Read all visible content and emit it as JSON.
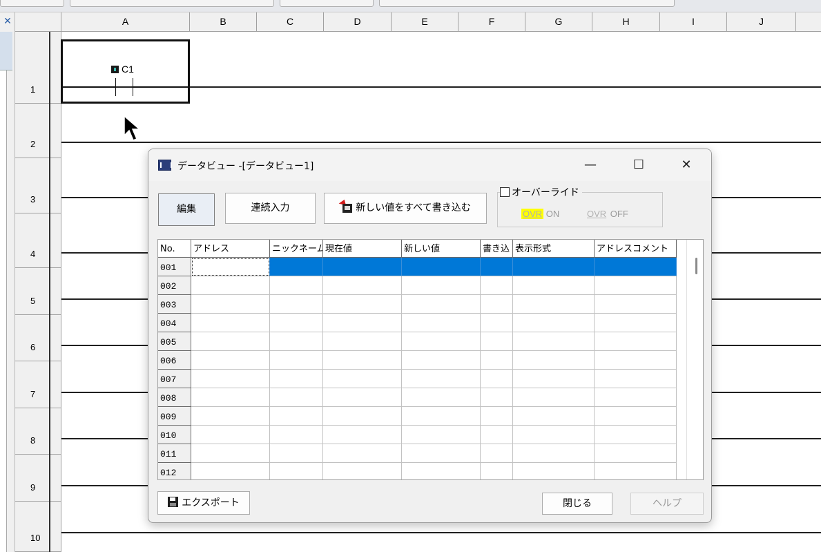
{
  "top_toolbar": {
    "buttons": [
      "",
      "",
      "",
      ""
    ]
  },
  "spreadsheet": {
    "columns": [
      "A",
      "B",
      "C",
      "D",
      "E",
      "F",
      "G",
      "H",
      "I",
      "J"
    ],
    "rows": [
      "1",
      "2",
      "3",
      "4",
      "5",
      "6",
      "7",
      "8",
      "9",
      "10"
    ]
  },
  "ladder": {
    "contact_device": "C1"
  },
  "dialog": {
    "title": "データビュー -[データビュー1]",
    "minimize": "—",
    "maximize": "☐",
    "close": "✕",
    "edit_button": "編集",
    "continuous_input_button": "連続入力",
    "write_all_button": "新しい値をすべて書き込む",
    "override_label": "オーバーライド",
    "ovr_on_tag": "OVR",
    "ovr_on_text": "ON",
    "ovr_off_tag": "OVR",
    "ovr_off_text": "OFF",
    "table": {
      "headers": [
        "No.",
        "アドレス",
        "ニックネーム",
        "現在値",
        "新しい値",
        "書き込",
        "表示形式",
        "アドレスコメント"
      ],
      "rows": [
        "001",
        "002",
        "003",
        "004",
        "005",
        "006",
        "007",
        "008",
        "009",
        "010",
        "011",
        "012"
      ],
      "selected_row": "001"
    },
    "export_button": "エクスポート",
    "close_button": "閉じる",
    "help_button": "ヘルプ"
  },
  "colors": {
    "selection": "#0078d7",
    "ovr_highlight": "#ffff00"
  }
}
